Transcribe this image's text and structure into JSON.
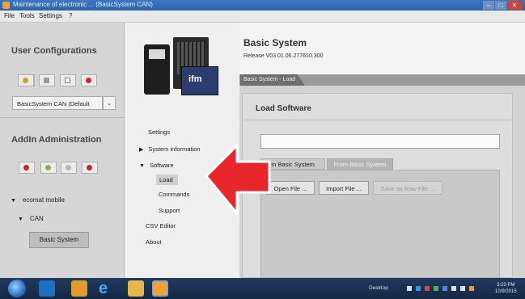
{
  "window": {
    "title": "Maintenance of electronic ... (BasicSystem CAN)",
    "controls": [
      "–",
      "□",
      "✕"
    ]
  },
  "menu": [
    "File",
    "Tools",
    "Settings",
    "?"
  ],
  "left_panel": {
    "user_config_title": "User Configurations",
    "config_select_value": "BasicSystem CAN (Default",
    "addin_title": "AddIn Administration",
    "tree": {
      "root": "ecomat mobile",
      "child": "CAN",
      "selected": "Basic System"
    }
  },
  "nav": {
    "settings": "Settings",
    "system_information": "System information",
    "software": "Software",
    "load": "Load",
    "commands": "Commands",
    "support": "Support",
    "csv_editor": "CSV Editor",
    "about": "About"
  },
  "device_logo": "ifm",
  "main": {
    "title": "Basic System",
    "release": "Release V03.01.06.277610.300",
    "tab": "Basic System - Load",
    "section_title": "Load Software",
    "path_value": "",
    "subtabs": [
      "In Basic System",
      "From Basic System"
    ],
    "buttons": {
      "open": "Open File ...",
      "import": "Import File ...",
      "save": "Save as Raw File ..."
    }
  },
  "taskbar": {
    "desktop_label": "Desktop",
    "time": "3:23 PM",
    "date": "10/9/2015"
  },
  "colors": {
    "arrow": "#e8262b",
    "tab_active": "#6f6f6f",
    "taskbar": "#132845",
    "title_bar": "#2e63a8"
  }
}
